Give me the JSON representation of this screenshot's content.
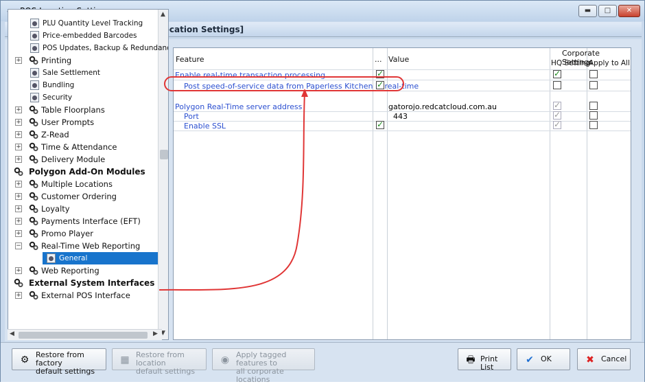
{
  "window": {
    "title": "POS Location Settings"
  },
  "header": {
    "text": "POS Location Settings  [Default Location Settings]"
  },
  "tree": {
    "items": [
      {
        "label": "PLU Quantity Level Tracking",
        "level": 2,
        "icon": "settings-page-icon"
      },
      {
        "label": "Price-embedded Barcodes",
        "level": 2,
        "icon": "settings-page-icon"
      },
      {
        "label": "POS Updates, Backup & Redundancy",
        "level": 2,
        "icon": "settings-page-icon"
      },
      {
        "label": "Printing",
        "level": 1,
        "icon": "gears-icon",
        "expander": "+"
      },
      {
        "label": "Sale Settlement",
        "level": 2,
        "icon": "settings-page-icon"
      },
      {
        "label": "Bundling",
        "level": 2,
        "icon": "settings-page-icon"
      },
      {
        "label": "Security",
        "level": 2,
        "icon": "settings-page-icon"
      },
      {
        "label": "Table Floorplans",
        "level": 1,
        "icon": "gears-icon",
        "expander": "+"
      },
      {
        "label": "User Prompts",
        "level": 1,
        "icon": "gears-icon",
        "expander": "+"
      },
      {
        "label": "Z-Read",
        "level": 1,
        "icon": "gears-icon",
        "expander": "+"
      },
      {
        "label": "Time & Attendance",
        "level": 1,
        "icon": "gears-icon",
        "expander": "+"
      },
      {
        "label": "Delivery Module",
        "level": 1,
        "icon": "gears-icon",
        "expander": "+"
      },
      {
        "label": "Polygon Add-On Modules",
        "level": 0,
        "icon": "gears-icon"
      },
      {
        "label": "Multiple Locations",
        "level": 1,
        "icon": "gears-icon",
        "expander": "+"
      },
      {
        "label": "Customer Ordering",
        "level": 1,
        "icon": "gears-icon",
        "expander": "+"
      },
      {
        "label": "Loyalty",
        "level": 1,
        "icon": "gears-icon",
        "expander": "+"
      },
      {
        "label": "Payments Interface (EFT)",
        "level": 1,
        "icon": "gears-icon",
        "expander": "+"
      },
      {
        "label": "Promo Player",
        "level": 1,
        "icon": "gears-icon",
        "expander": "+"
      },
      {
        "label": "Real-Time Web Reporting",
        "level": 1,
        "icon": "gears-icon",
        "expander": "-"
      },
      {
        "label": "General",
        "level": 2,
        "icon": "settings-page-icon",
        "selected": true
      },
      {
        "label": "Web Reporting",
        "level": 1,
        "icon": "gears-icon",
        "expander": "+"
      },
      {
        "label": "External System Interfaces",
        "level": 0,
        "icon": "gears-icon"
      },
      {
        "label": "External POS Interface",
        "level": 1,
        "icon": "gears-icon",
        "expander": "+"
      }
    ]
  },
  "grid": {
    "headers": {
      "feature": "Feature",
      "tag": "...",
      "value": "Value",
      "corporate": "Corporate Settings",
      "hq": "HQ Setting",
      "apply_all": "Apply to All"
    },
    "rows": [
      {
        "feature": "Enable real-time transaction processing",
        "indent": false,
        "tagged": true,
        "value": "",
        "hq_checked": true,
        "hq_disabled": false,
        "apply_checked": false
      },
      {
        "feature": "Post speed-of-service data from Paperless Kitchen in real-time",
        "indent": true,
        "tagged": true,
        "value": "",
        "hq_checked": false,
        "hq_disabled": false,
        "apply_checked": false
      },
      {
        "feature": "Polygon Real-Time server address",
        "indent": false,
        "tagged": false,
        "value": "gatorojo.redcatcloud.com.au",
        "hq_checked": true,
        "hq_disabled": true,
        "apply_checked": false
      },
      {
        "feature": "Port",
        "indent": true,
        "tagged": false,
        "value": "443",
        "hq_checked": true,
        "hq_disabled": true,
        "apply_checked": false
      },
      {
        "feature": "Enable SSL",
        "indent": true,
        "tagged": true,
        "value": "",
        "hq_checked": true,
        "hq_disabled": true,
        "apply_checked": false
      }
    ]
  },
  "footer": {
    "restore_factory": [
      "Restore from factory",
      "default settings"
    ],
    "restore_location": [
      "Restore from location",
      "default settings"
    ],
    "apply_tagged": [
      "Apply tagged features to",
      "all corporate locations"
    ],
    "print_list": "Print List",
    "ok": "OK",
    "cancel": "Cancel"
  },
  "colors": {
    "accent": "#1874cc",
    "link_blue": "#2b4fd0",
    "annotation_red": "#e03535"
  }
}
